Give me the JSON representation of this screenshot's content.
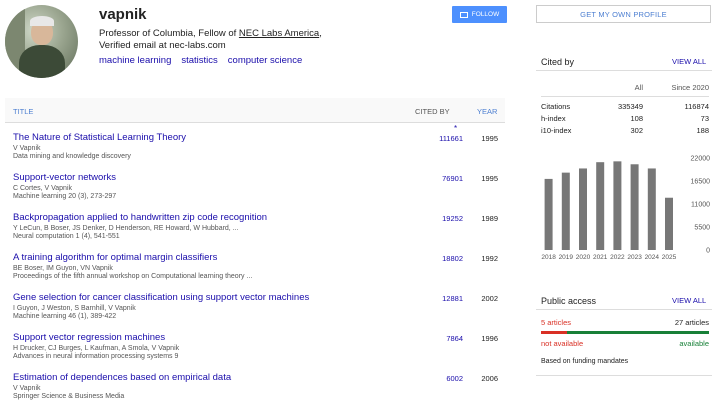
{
  "profile": {
    "name": "vapnik",
    "affiliation_prefix": "Professor of Columbia, Fellow of ",
    "affiliation_link": "NEC Labs America",
    "affiliation_suffix": ",",
    "email": "Verified email at nec-labs.com",
    "interests": [
      "machine learning",
      "statistics",
      "computer science"
    ]
  },
  "actions": {
    "follow_label": "FOLLOW",
    "get_profile_label": "GET MY OWN PROFILE"
  },
  "table": {
    "col_title": "TITLE",
    "col_cited": "CITED BY",
    "col_year": "YEAR",
    "star": "*",
    "articles": [
      {
        "title": "The Nature of Statistical Learning Theory",
        "authors": "V Vapnik",
        "venue": "Data mining and knowledge discovery",
        "cited": "111661",
        "year": "1995"
      },
      {
        "title": "Support-vector networks",
        "authors": "C Cortes, V Vapnik",
        "venue": "Machine learning 20 (3), 273-297",
        "cited": "76901",
        "year": "1995"
      },
      {
        "title": "Backpropagation applied to handwritten zip code recognition",
        "authors": "Y LeCun, B Boser, JS Denker, D Henderson, RE Howard, W Hubbard, ...",
        "venue": "Neural computation 1 (4), 541-551",
        "cited": "19252",
        "year": "1989"
      },
      {
        "title": "A training algorithm for optimal margin classifiers",
        "authors": "BE Boser, IM Guyon, VN Vapnik",
        "venue": "Proceedings of the fifth annual workshop on Computational learning theory ...",
        "cited": "18802",
        "year": "1992"
      },
      {
        "title": "Gene selection for cancer classification using support vector machines",
        "authors": "I Guyon, J Weston, S Barnhill, V Vapnik",
        "venue": "Machine learning 46 (1), 389-422",
        "cited": "12881",
        "year": "2002"
      },
      {
        "title": "Support vector regression machines",
        "authors": "H Drucker, CJ Burges, L Kaufman, A Smola, V Vapnik",
        "venue": "Advances in neural information processing systems 9",
        "cited": "7864",
        "year": "1996"
      },
      {
        "title": "Estimation of dependences based on empirical data",
        "authors": "V Vapnik",
        "venue": "Springer Science & Business Media",
        "cited": "6002",
        "year": "2006"
      }
    ]
  },
  "cited_by": {
    "title": "Cited by",
    "view_all": "VIEW ALL",
    "col_all": "All",
    "col_since": "Since 2020",
    "rows": [
      {
        "label": "Citations",
        "all": "335349",
        "since": "116874"
      },
      {
        "label": "h-index",
        "all": "108",
        "since": "73"
      },
      {
        "label": "i10-index",
        "all": "302",
        "since": "188"
      }
    ]
  },
  "chart_data": {
    "type": "bar",
    "categories": [
      "2018",
      "2019",
      "2020",
      "2021",
      "2022",
      "2023",
      "2024",
      "2025"
    ],
    "values": [
      17000,
      18500,
      19500,
      21000,
      21200,
      20500,
      19500,
      12500
    ],
    "yticks": [
      "22000",
      "16500",
      "11000",
      "5500",
      "0"
    ],
    "ylim": [
      0,
      22000
    ],
    "bar_color": "#777777"
  },
  "public_access": {
    "title": "Public access",
    "view_all": "VIEW ALL",
    "not_available_count": "5 articles",
    "available_count": "27 articles",
    "not_available_label": "not available",
    "available_label": "available",
    "not_available_fraction": 0.156,
    "note": "Based on funding mandates"
  },
  "colors": {
    "link": "#1a0dab",
    "accent": "#4d90fe",
    "red": "#d93025",
    "green": "#188038"
  }
}
